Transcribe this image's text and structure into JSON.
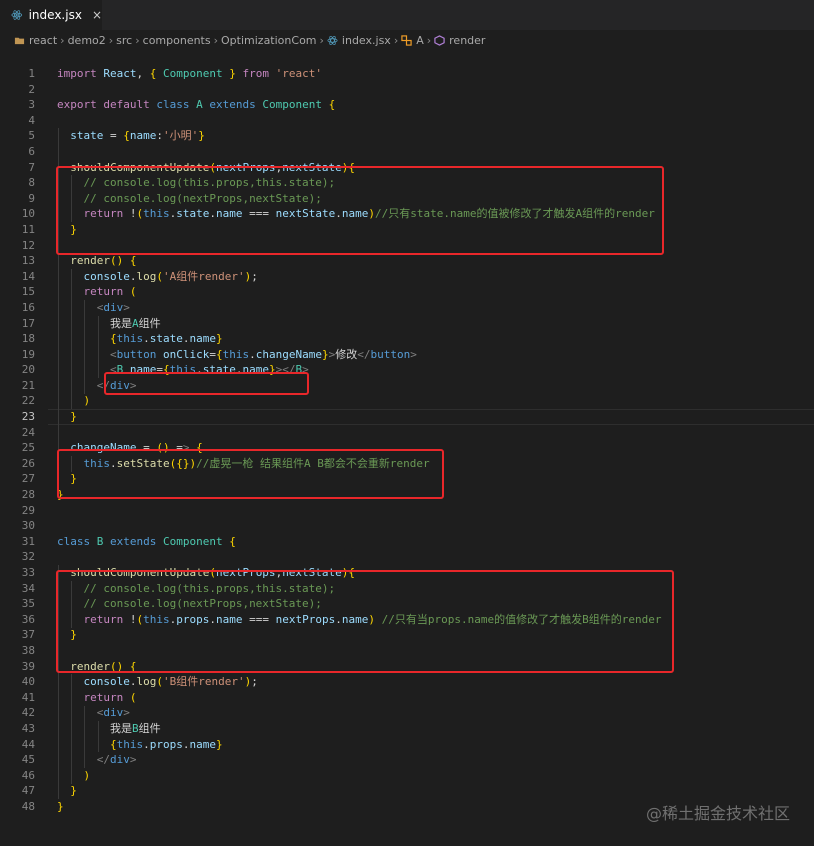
{
  "tab": {
    "label": "index.jsx",
    "close": "×",
    "icon": "react-icon"
  },
  "breadcrumb": [
    {
      "label": "react",
      "icon": "folder-icon"
    },
    {
      "label": "demo2"
    },
    {
      "label": "src"
    },
    {
      "label": "components"
    },
    {
      "label": "OptimizationCom"
    },
    {
      "label": "index.jsx",
      "icon": "react-icon"
    },
    {
      "label": "A",
      "icon": "class-icon"
    },
    {
      "label": "render",
      "icon": "method-icon"
    }
  ],
  "colors": {
    "keyword": "#569cd6",
    "control": "#c586c0",
    "function": "#dcdcaa",
    "variable": "#9cdcfe",
    "string": "#ce9178",
    "comment": "#6a9955",
    "class": "#4ec9b0",
    "text": "#d4d4d4",
    "tag": "#808080",
    "highlight_box": "#e8272a"
  },
  "code": [
    {
      "n": "1",
      "t": "import React, { Component } from 'react'"
    },
    {
      "n": "2",
      "t": ""
    },
    {
      "n": "3",
      "t": "export default class A extends Component {"
    },
    {
      "n": "4",
      "t": ""
    },
    {
      "n": "5",
      "t": "  state = {name:'小明'}"
    },
    {
      "n": "6",
      "t": ""
    },
    {
      "n": "7",
      "t": "  shouldComponentUpdate(nextProps,nextState){"
    },
    {
      "n": "8",
      "t": "    // console.log(this.props,this.state);"
    },
    {
      "n": "9",
      "t": "    // console.log(nextProps,nextState);"
    },
    {
      "n": "10",
      "t": "    return !(this.state.name === nextState.name)//只有state.name的值被修改了才触发A组件的render"
    },
    {
      "n": "11",
      "t": "  }"
    },
    {
      "n": "12",
      "t": ""
    },
    {
      "n": "13",
      "t": "  render() {"
    },
    {
      "n": "14",
      "t": "    console.log('A组件render');"
    },
    {
      "n": "15",
      "t": "    return ("
    },
    {
      "n": "16",
      "t": "      <div>"
    },
    {
      "n": "17",
      "t": "        我是A组件"
    },
    {
      "n": "18",
      "t": "        {this.state.name}"
    },
    {
      "n": "19",
      "t": "        <button onClick={this.changeName}>修改</button>"
    },
    {
      "n": "20",
      "t": "        <B name={this.state.name}></B>"
    },
    {
      "n": "21",
      "t": "      </div>"
    },
    {
      "n": "22",
      "t": "    )"
    },
    {
      "n": "23",
      "t": "  }"
    },
    {
      "n": "24",
      "t": ""
    },
    {
      "n": "25",
      "t": "  changeName = () => {"
    },
    {
      "n": "26",
      "t": "    this.setState({})//虚晃一枪 结果组件A B都会不会重新render"
    },
    {
      "n": "27",
      "t": "  }"
    },
    {
      "n": "28",
      "t": "}"
    },
    {
      "n": "29",
      "t": ""
    },
    {
      "n": "30",
      "t": ""
    },
    {
      "n": "31",
      "t": "class B extends Component {"
    },
    {
      "n": "32",
      "t": ""
    },
    {
      "n": "33",
      "t": "  shouldComponentUpdate(nextProps,nextState){"
    },
    {
      "n": "34",
      "t": "    // console.log(this.props,this.state);"
    },
    {
      "n": "35",
      "t": "    // console.log(nextProps,nextState);"
    },
    {
      "n": "36",
      "t": "    return !(this.props.name === nextProps.name) //只有当props.name的值修改了才触发B组件的render"
    },
    {
      "n": "37",
      "t": "  }"
    },
    {
      "n": "38",
      "t": ""
    },
    {
      "n": "39",
      "t": "  render() {"
    },
    {
      "n": "40",
      "t": "    console.log('B组件render');"
    },
    {
      "n": "41",
      "t": "    return ("
    },
    {
      "n": "42",
      "t": "      <div>"
    },
    {
      "n": "43",
      "t": "        我是B组件"
    },
    {
      "n": "44",
      "t": "        {this.props.name}"
    },
    {
      "n": "45",
      "t": "      </div>"
    },
    {
      "n": "46",
      "t": "    )"
    },
    {
      "n": "47",
      "t": "  }"
    },
    {
      "n": "48",
      "t": "}"
    }
  ],
  "watermark": "@稀土掘金技术社区"
}
